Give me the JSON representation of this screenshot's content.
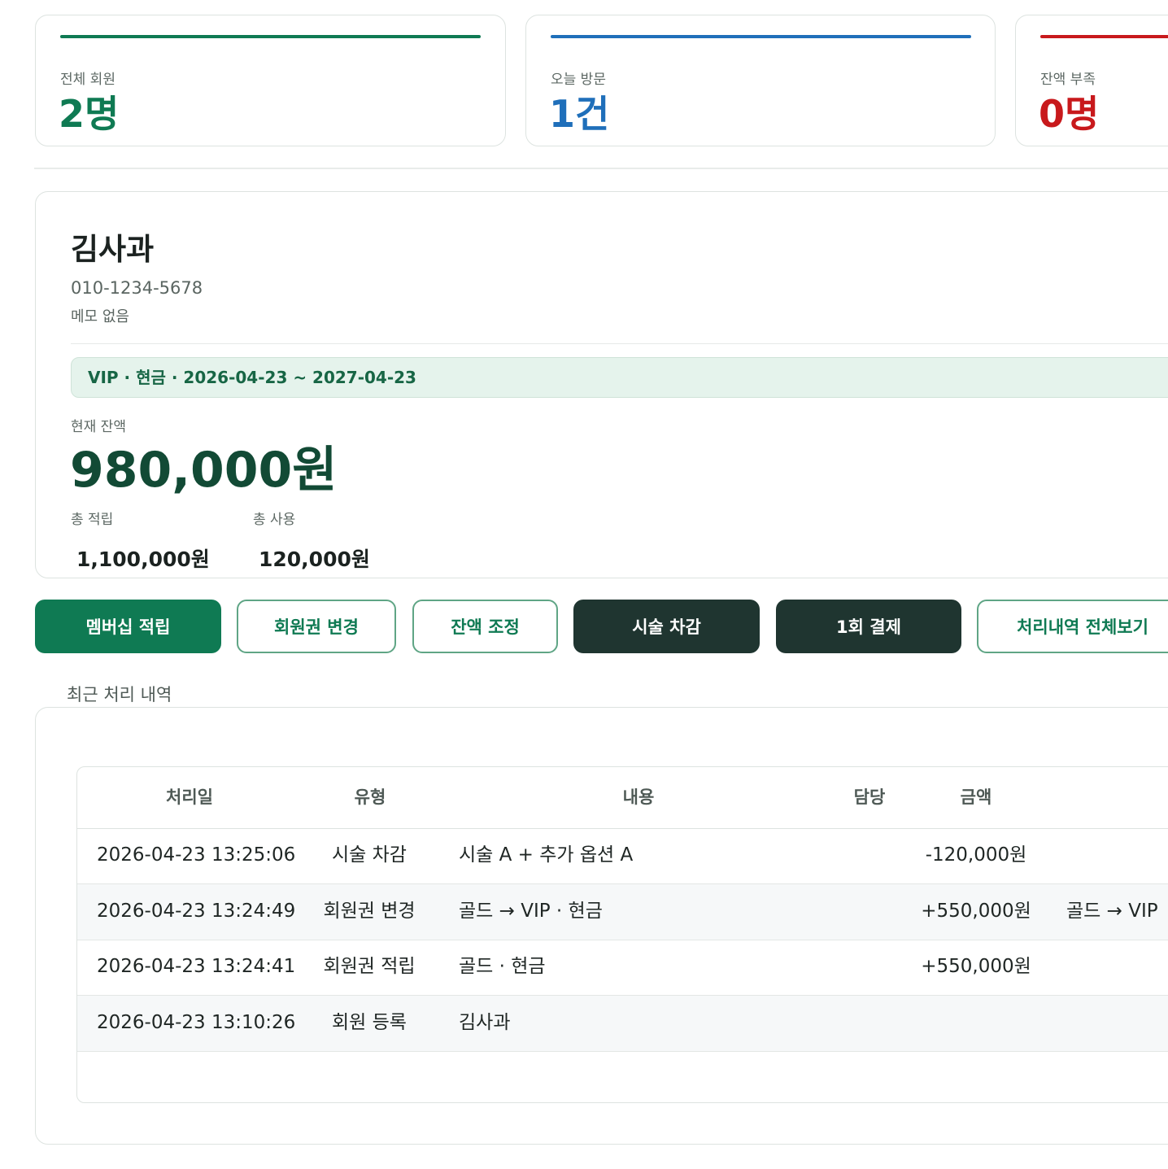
{
  "stats": [
    {
      "label": "전체 회원",
      "value": "2명",
      "color": "#0f7a53"
    },
    {
      "label": "오늘 방문",
      "value": "1건",
      "color": "#1f6fba"
    },
    {
      "label": "잔액 부족",
      "value": "0명",
      "color": "#c8191c"
    }
  ],
  "member": {
    "name": "김사과",
    "phone": "010-1234-5678",
    "memo": "메모 없음",
    "membership": "VIP · 현금 · 2026-04-23 ~ 2027-04-23",
    "balance_label": "현재 잔액",
    "balance": "980,000원",
    "total_earned_label": "총 적립",
    "total_earned": "1,100,000원",
    "total_used_label": "총 사용",
    "total_used": "120,000원"
  },
  "actions": {
    "earn": "멤버십 적립",
    "change": "회원권 변경",
    "adjust": "잔액 조정",
    "deduct": "시술 차감",
    "single_pay": "1회 결제",
    "view_all": "처리내역 전체보기"
  },
  "history": {
    "title": "최근 처리 내역",
    "headers": [
      "처리일",
      "유형",
      "내용",
      "담당",
      "금액"
    ],
    "rows": [
      {
        "date": "2026-04-23 13:25:06",
        "type": "시술 차감",
        "content": "시술 A + 추가 옵션 A",
        "staff": "",
        "amount": "-120,000원",
        "extra": ""
      },
      {
        "date": "2026-04-23 13:24:49",
        "type": "회원권 변경",
        "content": "골드 → VIP · 현금",
        "staff": "",
        "amount": "+550,000원",
        "extra": "골드 → VIP"
      },
      {
        "date": "2026-04-23 13:24:41",
        "type": "회원권 적립",
        "content": "골드 · 현금",
        "staff": "",
        "amount": "+550,000원",
        "extra": ""
      },
      {
        "date": "2026-04-23 13:10:26",
        "type": "회원 등록",
        "content": "김사과",
        "staff": "",
        "amount": "",
        "extra": ""
      }
    ]
  }
}
